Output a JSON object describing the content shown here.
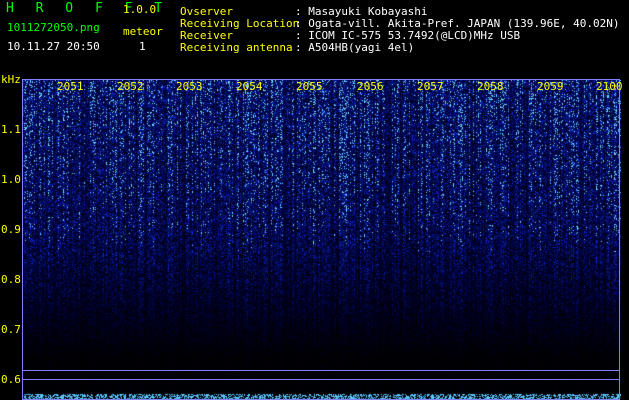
{
  "app": {
    "title": "H R O F F T",
    "version": "1.0.0"
  },
  "file": {
    "name": "1011272050.png",
    "datetime": "10.11.27 20:50",
    "meteor_label": "meteor",
    "meteor_count": "1"
  },
  "info": [
    {
      "label": "Ovserver",
      "value": ": Masayuki Kobayashi"
    },
    {
      "label": "Receiving Location",
      "value": ": Ogata-vill. Akita-Pref. JAPAN (139.96E, 40.02N)"
    },
    {
      "label": "Receiver",
      "value": ": ICOM IC-575 53.7492(@LCD)MHz USB"
    },
    {
      "label": "Receiving antenna",
      "value": ": A504HB(yagi 4el)"
    }
  ],
  "axis": {
    "y_unit": "kHz",
    "x_ticks": [
      "2051",
      "2052",
      "2053",
      "2054",
      "2055",
      "2056",
      "2057",
      "2058",
      "2059",
      "2100"
    ],
    "y_ticks": [
      "1.1",
      "1.0",
      "0.9",
      "0.8",
      "0.7",
      "0.6"
    ]
  },
  "colors": {
    "background": "#000000",
    "title": "#00ff00",
    "tick": "#ffff00",
    "signal_high": "#2a4cff",
    "signal_peak": "#6fd8ff",
    "frame": "#8080ff"
  }
}
